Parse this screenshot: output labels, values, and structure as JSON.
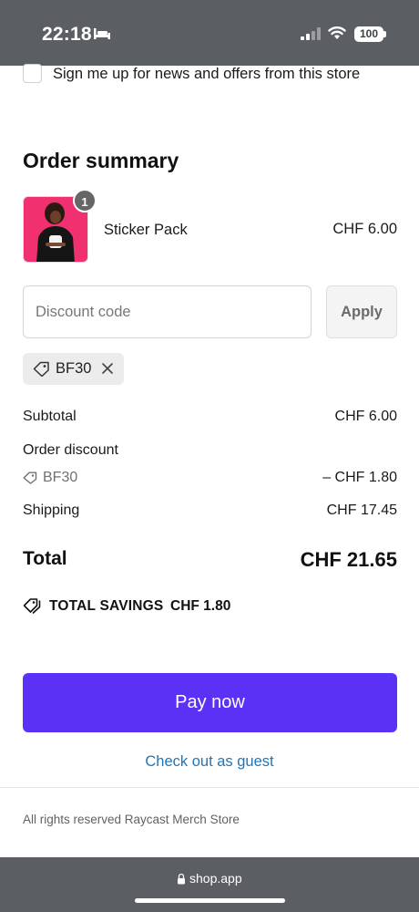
{
  "status_bar": {
    "time": "22:18",
    "battery": "100"
  },
  "newsletter": {
    "label": "Sign me up for news and offers from this store",
    "checked": false
  },
  "order_summary": {
    "title": "Order summary",
    "item": {
      "name": "Sticker Pack",
      "price": "CHF 6.00",
      "quantity": "1"
    },
    "discount": {
      "placeholder": "Discount code",
      "apply_label": "Apply",
      "applied_code": "BF30"
    },
    "lines": {
      "subtotal_label": "Subtotal",
      "subtotal_value": "CHF 6.00",
      "order_discount_label": "Order discount",
      "discount_code": "BF30",
      "discount_value": "– CHF 1.80",
      "shipping_label": "Shipping",
      "shipping_value": "CHF 17.45"
    },
    "total_label": "Total",
    "total_value": "CHF 21.65",
    "savings_label": "TOTAL SAVINGS",
    "savings_value": "CHF 1.80"
  },
  "actions": {
    "pay_label": "Pay now",
    "guest_label": "Check out as guest"
  },
  "footer": {
    "text": "All rights reserved Raycast Merch Store"
  },
  "browser": {
    "url": "shop.app"
  },
  "colors": {
    "accent": "#5b32f5",
    "link": "#1f75b8",
    "bar_gray": "#5b5f64"
  }
}
